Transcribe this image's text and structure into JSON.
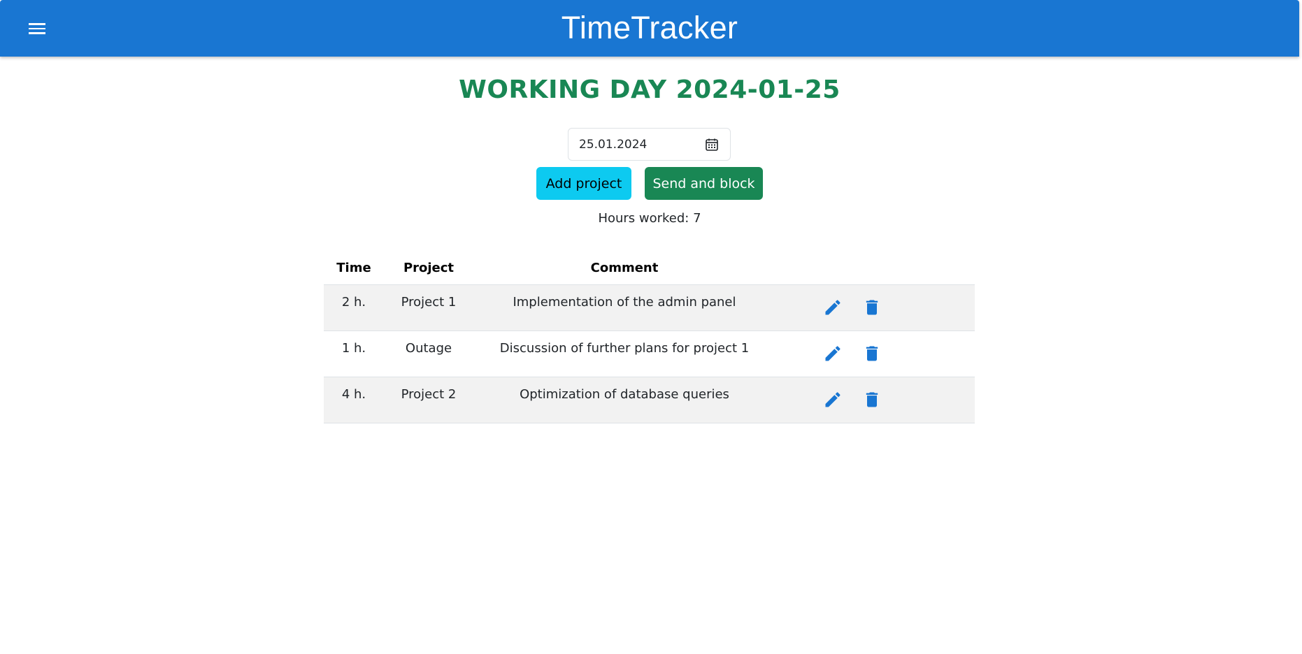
{
  "app": {
    "title": "TimeTracker",
    "menu_icon": "hamburger-menu-icon",
    "brand_color": "#1976d2"
  },
  "page": {
    "title": "WORKING DAY 2024-01-25",
    "title_color": "#198754"
  },
  "date_picker": {
    "value": "25.01.2024",
    "icon": "calendar-icon"
  },
  "actions": {
    "add_label": "Add project",
    "add_color": "#0dcaf0",
    "send_label": "Send and block",
    "send_color": "#198754"
  },
  "summary": {
    "hours_text": "Hours worked: 7"
  },
  "table": {
    "headers": {
      "time": "Time",
      "project": "Project",
      "comment": "Comment"
    },
    "rows": [
      {
        "time": "2 h.",
        "project": "Project 1",
        "comment": "Implementation of the admin panel"
      },
      {
        "time": "1 h.",
        "project": "Outage",
        "comment": "Discussion of further plans for project 1"
      },
      {
        "time": "4 h.",
        "project": "Project 2",
        "comment": "Optimization of database queries"
      }
    ],
    "row_icons": {
      "edit": "pencil-icon",
      "delete": "trash-icon"
    },
    "icon_color": "#1976d2"
  }
}
